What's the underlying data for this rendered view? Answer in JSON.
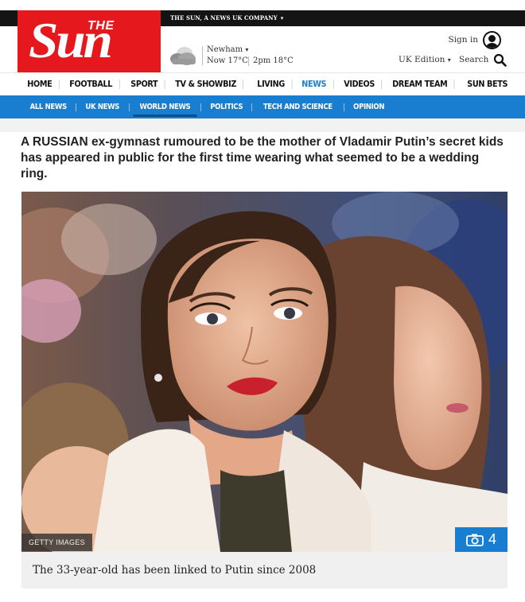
{
  "topbar": {
    "corp_label": "THE SUN, A NEWS UK COMPANY",
    "caret": "▾"
  },
  "logo": {
    "the": "THE",
    "sun": "Sun",
    "brand_color": "#e5181d"
  },
  "weather": {
    "location": "Newham",
    "caret": "▾",
    "now": "Now 17°C",
    "later": "2pm 18°C",
    "icon": "cloud-icon"
  },
  "account": {
    "signin_label": "Sign in",
    "icon": "user-icon"
  },
  "edition": {
    "label": "UK Edition",
    "caret": "▾"
  },
  "search": {
    "label": "Search",
    "icon": "search-icon"
  },
  "main_nav": {
    "items": [
      {
        "label": "HOME"
      },
      {
        "label": "FOOTBALL"
      },
      {
        "label": "SPORT"
      },
      {
        "label": "TV & SHOWBIZ"
      },
      {
        "label": "LIVING"
      },
      {
        "label": "NEWS"
      },
      {
        "label": "VIDEOS"
      },
      {
        "label": "DREAM TEAM"
      },
      {
        "label": "SUN BETS"
      }
    ],
    "active": "NEWS",
    "accent": "#1a7ed0"
  },
  "sub_nav": {
    "items": [
      {
        "label": "ALL NEWS"
      },
      {
        "label": "UK NEWS"
      },
      {
        "label": "WORLD NEWS"
      },
      {
        "label": "POLITICS"
      },
      {
        "label": "TECH AND SCIENCE"
      },
      {
        "label": "OPINION"
      }
    ],
    "active": "WORLD NEWS",
    "background": "#1a7ed0"
  },
  "article": {
    "lede": "A RUSSIAN ex-gymnast rumoured to be the mother of Vladamir Putin’s secret kids has appeared in public for the first time wearing what seemed to be a wedding ring.",
    "image": {
      "credit": "GETTY IMAGES",
      "gallery_count": "4",
      "gallery_icon": "camera-icon"
    },
    "caption": "The 33-year-old has been linked to Putin since 2008"
  }
}
